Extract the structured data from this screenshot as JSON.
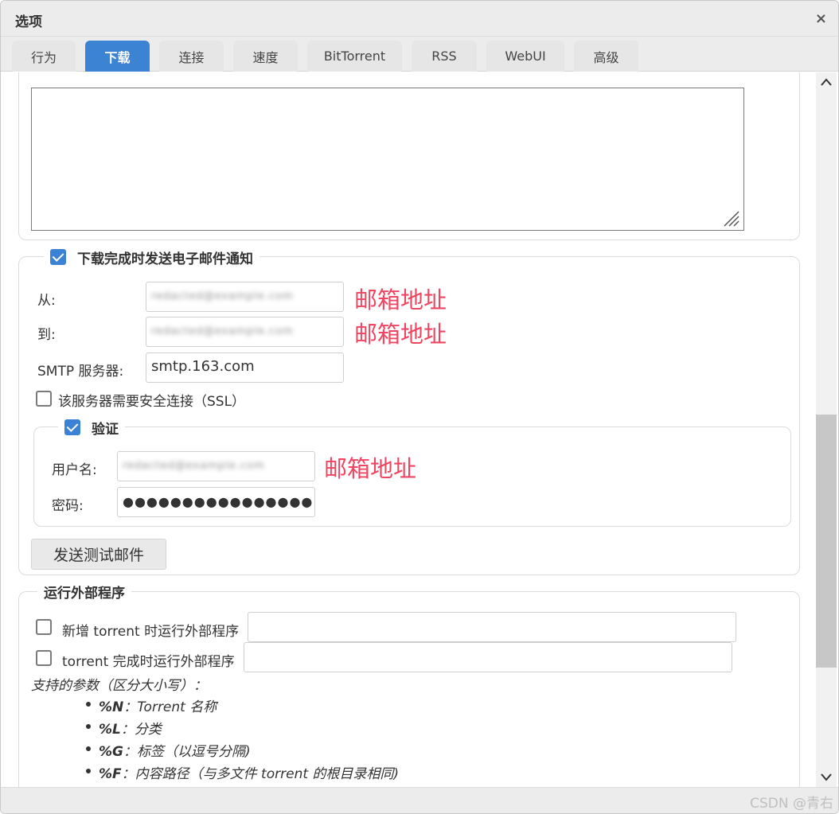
{
  "window": {
    "title": "选项",
    "close_glyph": "×"
  },
  "tabs": [
    {
      "label": "行为",
      "active": false
    },
    {
      "label": "下载",
      "active": true
    },
    {
      "label": "连接",
      "active": false
    },
    {
      "label": "速度",
      "active": false
    },
    {
      "label": "BitTorrent",
      "active": false
    },
    {
      "label": "RSS",
      "active": false
    },
    {
      "label": "WebUI",
      "active": false
    },
    {
      "label": "高级",
      "active": false
    }
  ],
  "email": {
    "section_label": "下载完成时发送电子邮件通知",
    "enabled": true,
    "from_label": "从:",
    "from_value": "",
    "to_label": "到:",
    "to_value": "",
    "smtp_label": "SMTP 服务器:",
    "smtp_value": "smtp.163.com",
    "ssl_label": "该服务器需要安全连接（SSL）",
    "ssl_checked": false,
    "auth": {
      "label": "验证",
      "enabled": true,
      "username_label": "用户名:",
      "username_value": "",
      "password_label": "密码:",
      "password_value": "●●●●●●●●●●●●●●●●"
    },
    "test_button": "发送测试邮件"
  },
  "annotations": [
    "邮箱地址",
    "邮箱地址",
    "邮箱地址"
  ],
  "external": {
    "section_label": "运行外部程序",
    "on_add_label": "新增 torrent 时运行外部程序",
    "on_add_checked": false,
    "on_finish_label": "torrent 完成时运行外部程序",
    "on_finish_checked": false,
    "help_title": "支持的参数（区分大小写）：",
    "params": [
      {
        "key": "%N",
        "desc": "：Torrent 名称"
      },
      {
        "key": "%L",
        "desc": "：分类"
      },
      {
        "key": "%G",
        "desc": "：标签（以逗号分隔)"
      },
      {
        "key": "%F",
        "desc": "：内容路径（与多文件 torrent 的根目录相同)"
      }
    ]
  },
  "watermark": "CSDN @青右",
  "colors": {
    "accent": "#3d83d3",
    "annotation": "#ef4561"
  }
}
